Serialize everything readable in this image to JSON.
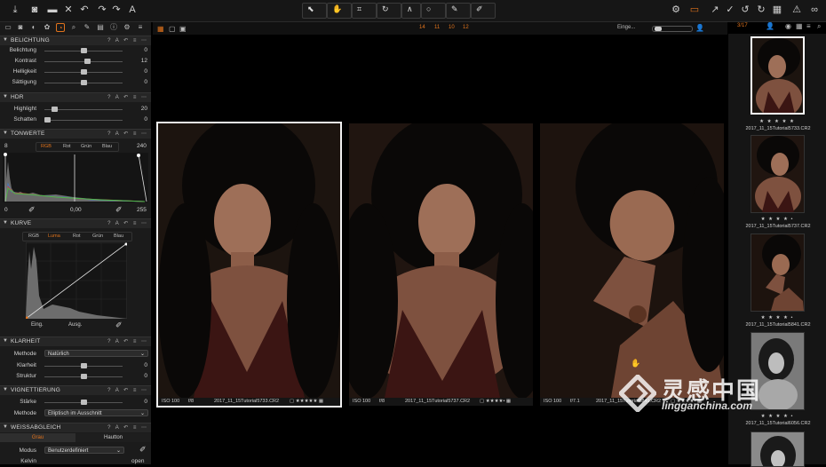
{
  "toolbar": {
    "left_icons": [
      "download-icon",
      "camera-icon",
      "folder-icon",
      "delete-icon",
      "undo-icon",
      "redo-icon",
      "redo-alt-icon",
      "text-icon"
    ],
    "right_icons": [
      "gear-icon",
      "layers-icon",
      "arrow-icon",
      "check-icon",
      "rotate-left-icon",
      "rotate-right-icon",
      "grid-icon",
      "warning-icon",
      "glasses-icon"
    ]
  },
  "viewer_bar": {
    "numbers": [
      "14",
      "11",
      "10",
      "12"
    ],
    "right_label": "Einge...",
    "counter": "3/17"
  },
  "panels": {
    "belichtung": {
      "title": "BELICHTUNG",
      "rows": [
        {
          "label": "Belichtung",
          "value": "0",
          "pos": 0.5
        },
        {
          "label": "Kontrast",
          "value": "12",
          "pos": 0.56
        },
        {
          "label": "Helligkeit",
          "value": "0",
          "pos": 0.5
        },
        {
          "label": "Sättigung",
          "value": "0",
          "pos": 0.5
        }
      ]
    },
    "hdr": {
      "title": "HDR",
      "rows": [
        {
          "label": "Highlight",
          "value": "20",
          "pos": 0.1
        },
        {
          "label": "Schatten",
          "value": "0",
          "pos": 0.0
        }
      ]
    },
    "tonwerte": {
      "title": "TONWERTE",
      "channels": [
        "RGB",
        "Rot",
        "Grün",
        "Blau"
      ],
      "left_value": "8",
      "right_value": "240",
      "bottom_left": "0",
      "bottom_mid": "0,00",
      "bottom_right": "255"
    },
    "kurve": {
      "title": "KURVE",
      "channels": [
        "RGB",
        "Luma",
        "Rot",
        "Grün",
        "Blau"
      ],
      "input_label": "Eing.",
      "output_label": "Ausg."
    },
    "klarheit": {
      "title": "KLARHEIT",
      "method_label": "Methode",
      "method_value": "Natürlich",
      "rows": [
        {
          "label": "Klarheit",
          "value": "0",
          "pos": 0.5
        },
        {
          "label": "Struktur",
          "value": "0",
          "pos": 0.5
        }
      ]
    },
    "vignettierung": {
      "title": "VIGNETTIERUNG",
      "rows": [
        {
          "label": "Stärke",
          "value": "0",
          "pos": 0.5
        }
      ],
      "method_label": "Methode",
      "method_value": "Elliptisch im Ausschnitt"
    },
    "weissabgleich": {
      "title": "WEISSABGLEICH",
      "tabs": [
        "Grau",
        "Hautton"
      ],
      "mode_label": "Modus",
      "mode_value": "Benutzerdefiniert",
      "kelvin_label": "Kelvin",
      "kelvin_value": "open"
    }
  },
  "photos": [
    {
      "iso": "ISO 100",
      "aperture": "f/8",
      "name": "2017_11_15Tutorial5733.CR2",
      "selected": true
    },
    {
      "iso": "ISO 100",
      "aperture": "f/8",
      "name": "2017_11_15Tutorial5737.CR2",
      "selected": false
    },
    {
      "iso": "ISO 100",
      "aperture": "f/7.1",
      "name": "2017_11_15Tutorial5841.CR2",
      "selected": false
    }
  ],
  "filmstrip": [
    {
      "name": "2017_11_15Tutorial5733.CR2",
      "stars": "★ ★ ★ ★ ★",
      "selected": true
    },
    {
      "name": "2017_11_15Tutorial5737.CR2",
      "stars": "★ ★ ★ ★ •",
      "selected": false
    },
    {
      "name": "2017_11_15Tutorial5841.CR2",
      "stars": "★ ★ ★ ★ •",
      "selected": false
    },
    {
      "name": "2017_11_15Tutorial6056.CR2",
      "stars": "★ ★ ★ ★ •",
      "selected": false
    }
  ],
  "watermark": {
    "title": "灵感中国",
    "subtitle": "lingganchina.com"
  },
  "colors": {
    "accent": "#e0731c",
    "panel_bg": "#1b1b1b",
    "selection": "#ffffff"
  }
}
